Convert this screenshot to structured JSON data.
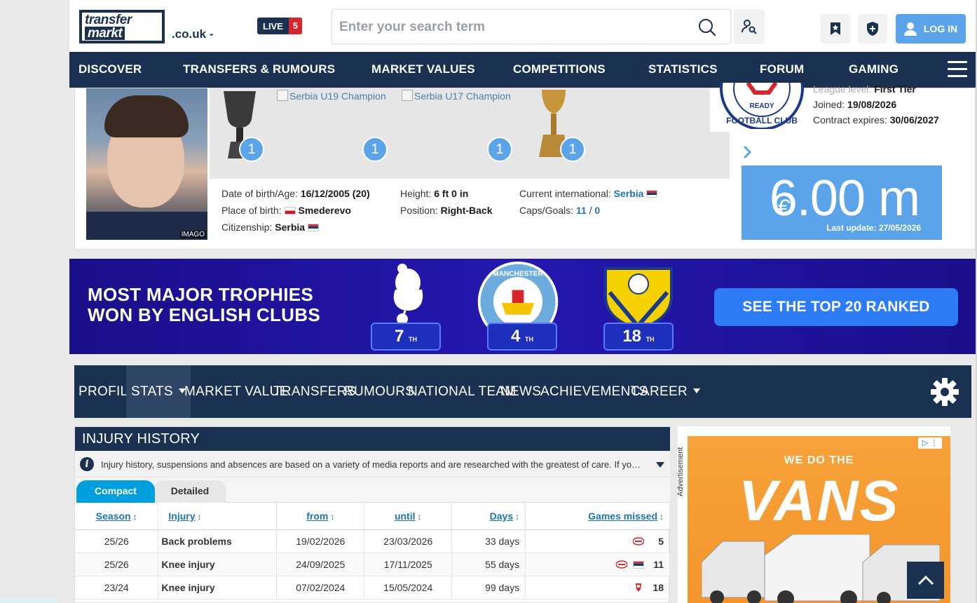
{
  "header": {
    "logo_line1": "transfer",
    "logo_line2": "markt",
    "domain": ".co.uk -",
    "live_label": "LIVE",
    "live_count": "5",
    "search_placeholder": "Enter your search term",
    "login_label": "LOG IN"
  },
  "nav": {
    "items": [
      "DISCOVER",
      "TRANSFERS & RUMOURS",
      "MARKET VALUES",
      "COMPETITIONS",
      "STATISTICS",
      "FORUM",
      "GAMING"
    ]
  },
  "profile": {
    "photo_credit": "IMAGO",
    "trophies": [
      {
        "alt": "",
        "count": "1"
      },
      {
        "alt": "Serbia U19 Champion",
        "count": "1"
      },
      {
        "alt": "Serbia U17 Champion",
        "count": "1"
      },
      {
        "alt": "",
        "count": "1"
      }
    ],
    "club": {
      "league_label": "League level:",
      "league_value": "First Tier",
      "joined_label": "Joined:",
      "joined_value": "19/08/2026",
      "contract_label": "Contract expires:",
      "contract_value": "30/06/2027"
    },
    "facts": {
      "dob_label": "Date of birth/Age:",
      "dob_value": "16/12/2005 (20)",
      "pob_label": "Place of birth:",
      "pob_value": "Smederevo",
      "citizenship_label": "Citizenship:",
      "citizenship_value": "Serbia",
      "height_label": "Height:",
      "height_value": "6 ft 0 in",
      "position_label": "Position:",
      "position_value": "Right-Back",
      "intl_label": "Current international:",
      "intl_value": "Serbia",
      "caps_label": "Caps/Goals:",
      "caps_value": "11",
      "caps_sep": "/",
      "goals_value": "0"
    },
    "market_value": {
      "currency": "€",
      "value": "6.00 m",
      "last_update": "Last update: 27/05/2026"
    }
  },
  "banner": {
    "line1": "MOST MAJOR TROPHIES",
    "line2": "WON BY ENGLISH CLUBS",
    "ranks": [
      {
        "num": "7",
        "suffix": "TH"
      },
      {
        "num": "4",
        "suffix": "TH"
      },
      {
        "num": "18",
        "suffix": "TH"
      }
    ],
    "crest_text": "MANCHESTER",
    "cta": "SEE THE TOP 20 RANKED"
  },
  "tabs": [
    "PROFILE",
    "STATS",
    "MARKET VALUE",
    "TRANSFERS",
    "RUMOURS",
    "NATIONAL TEAM",
    "NEWS",
    "ACHIEVEMENTS",
    "CAREER"
  ],
  "injury": {
    "title": "INJURY HISTORY",
    "info": "Injury history, suspensions and absences are based on a variety of media reports and are researched with the greatest of care. If you should notice any errors, please contact us.",
    "subtabs": [
      "Compact",
      "Detailed"
    ],
    "columns": [
      "Season",
      "Injury",
      "from",
      "until",
      "Days",
      "Games missed"
    ],
    "rows": [
      {
        "season": "25/26",
        "injury": "Back problems",
        "from": "19/02/2026",
        "until": "23/03/2026",
        "days": "33 days",
        "games": "5"
      },
      {
        "season": "25/26",
        "injury": "Knee injury",
        "from": "24/09/2025",
        "until": "17/11/2025",
        "days": "55 days",
        "games": "11"
      },
      {
        "season": "23/24",
        "injury": "Knee injury",
        "from": "07/02/2024",
        "until": "15/05/2024",
        "days": "99 days",
        "games": "18"
      }
    ]
  },
  "ad": {
    "label": "Advertisement",
    "headline": "WE DO THE",
    "brand": "VANS"
  },
  "colors": {
    "navy": "#1a3151",
    "accent_blue": "#5ba4e9",
    "link_blue": "#1d75b3",
    "banner_blue": "#2418b0"
  }
}
